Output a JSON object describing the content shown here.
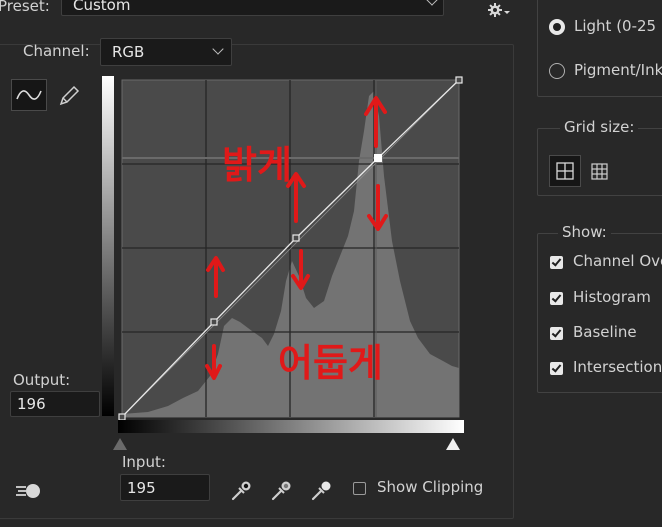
{
  "preset": {
    "label": "Preset:",
    "value": "Custom"
  },
  "channel": {
    "label": "Channel:",
    "value": "RGB"
  },
  "output": {
    "label": "Output:",
    "value": "196"
  },
  "input": {
    "label": "Input:",
    "value": "195"
  },
  "show_clipping": {
    "label": "Show Clipping",
    "checked": false
  },
  "show_amount": {
    "options": [
      {
        "label": "Light  (0-25",
        "selected": true
      },
      {
        "label": "Pigment/Ink",
        "selected": false
      }
    ]
  },
  "grid_size": {
    "label": "Grid size:"
  },
  "show": {
    "label": "Show:",
    "items": [
      {
        "label": "Channel Ove",
        "checked": true
      },
      {
        "label": "Histogram",
        "checked": true
      },
      {
        "label": "Baseline",
        "checked": true
      },
      {
        "label": "Intersection",
        "checked": true
      }
    ]
  },
  "annotations": {
    "top": "밝게",
    "bottom": "어둡게"
  },
  "colors": {
    "background": "#282828",
    "graph": "#4a4a4a",
    "histogram": "#737373",
    "annotation": "#e01919"
  },
  "icons": [
    "gear-icon",
    "curve-tool-icon",
    "pencil-icon",
    "eyedropper-black-icon",
    "eyedropper-gray-icon",
    "eyedropper-white-icon",
    "auto-adjust-icon"
  ]
}
